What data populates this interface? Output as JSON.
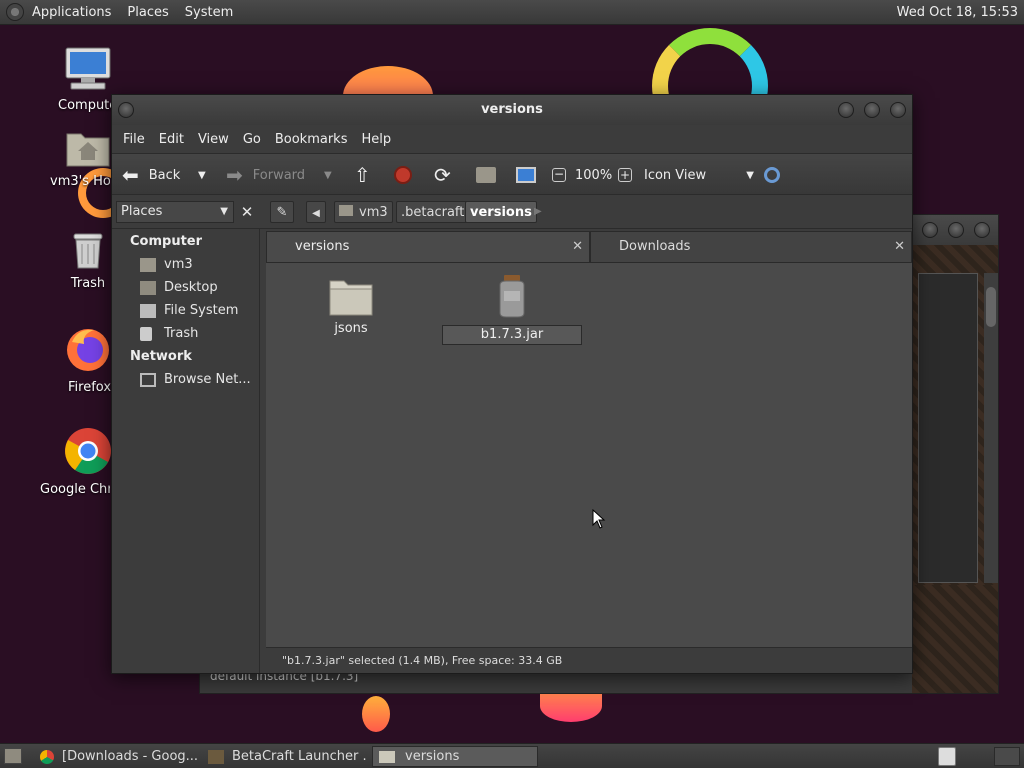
{
  "top_panel": {
    "menus": [
      "Applications",
      "Places",
      "System"
    ],
    "clock": "Wed Oct 18, 15:53"
  },
  "desktop": {
    "icons": [
      {
        "label": "Computer"
      },
      {
        "label": "vm3's Home"
      },
      {
        "label": "Trash"
      },
      {
        "label": "Firefox"
      },
      {
        "label": "Google Chrome"
      }
    ]
  },
  "background_window": {
    "status_text": "default instance [b1.7.3]"
  },
  "window": {
    "title": "versions",
    "menu": [
      "File",
      "Edit",
      "View",
      "Go",
      "Bookmarks",
      "Help"
    ],
    "toolbar": {
      "back_label": "Back",
      "forward_label": "Forward",
      "zoom": "100%",
      "view_mode": "Icon View"
    },
    "sidebar": {
      "selector": "Places",
      "sections": [
        {
          "heading": "Computer",
          "items": [
            "vm3",
            "Desktop",
            "File System",
            "Trash"
          ]
        },
        {
          "heading": "Network",
          "items": [
            "Browse Net..."
          ]
        }
      ]
    },
    "breadcrumbs": [
      "vm3",
      ".betacraft",
      "versions"
    ],
    "tabs": [
      {
        "label": "versions",
        "active": true
      },
      {
        "label": "Downloads",
        "active": false
      }
    ],
    "files": [
      {
        "name": "jsons",
        "icon": "folder-icon"
      },
      {
        "name": "b1.7.3.jar",
        "icon": "jar-icon",
        "selected": true
      }
    ],
    "status": "\"b1.7.3.jar\" selected (1.4 MB), Free space: 33.4 GB"
  },
  "taskbar": {
    "tasks": [
      {
        "label": "[Downloads - Goog...",
        "active": false
      },
      {
        "label": "BetaCraft Launcher ...",
        "active": false
      },
      {
        "label": "versions",
        "active": true
      }
    ]
  }
}
